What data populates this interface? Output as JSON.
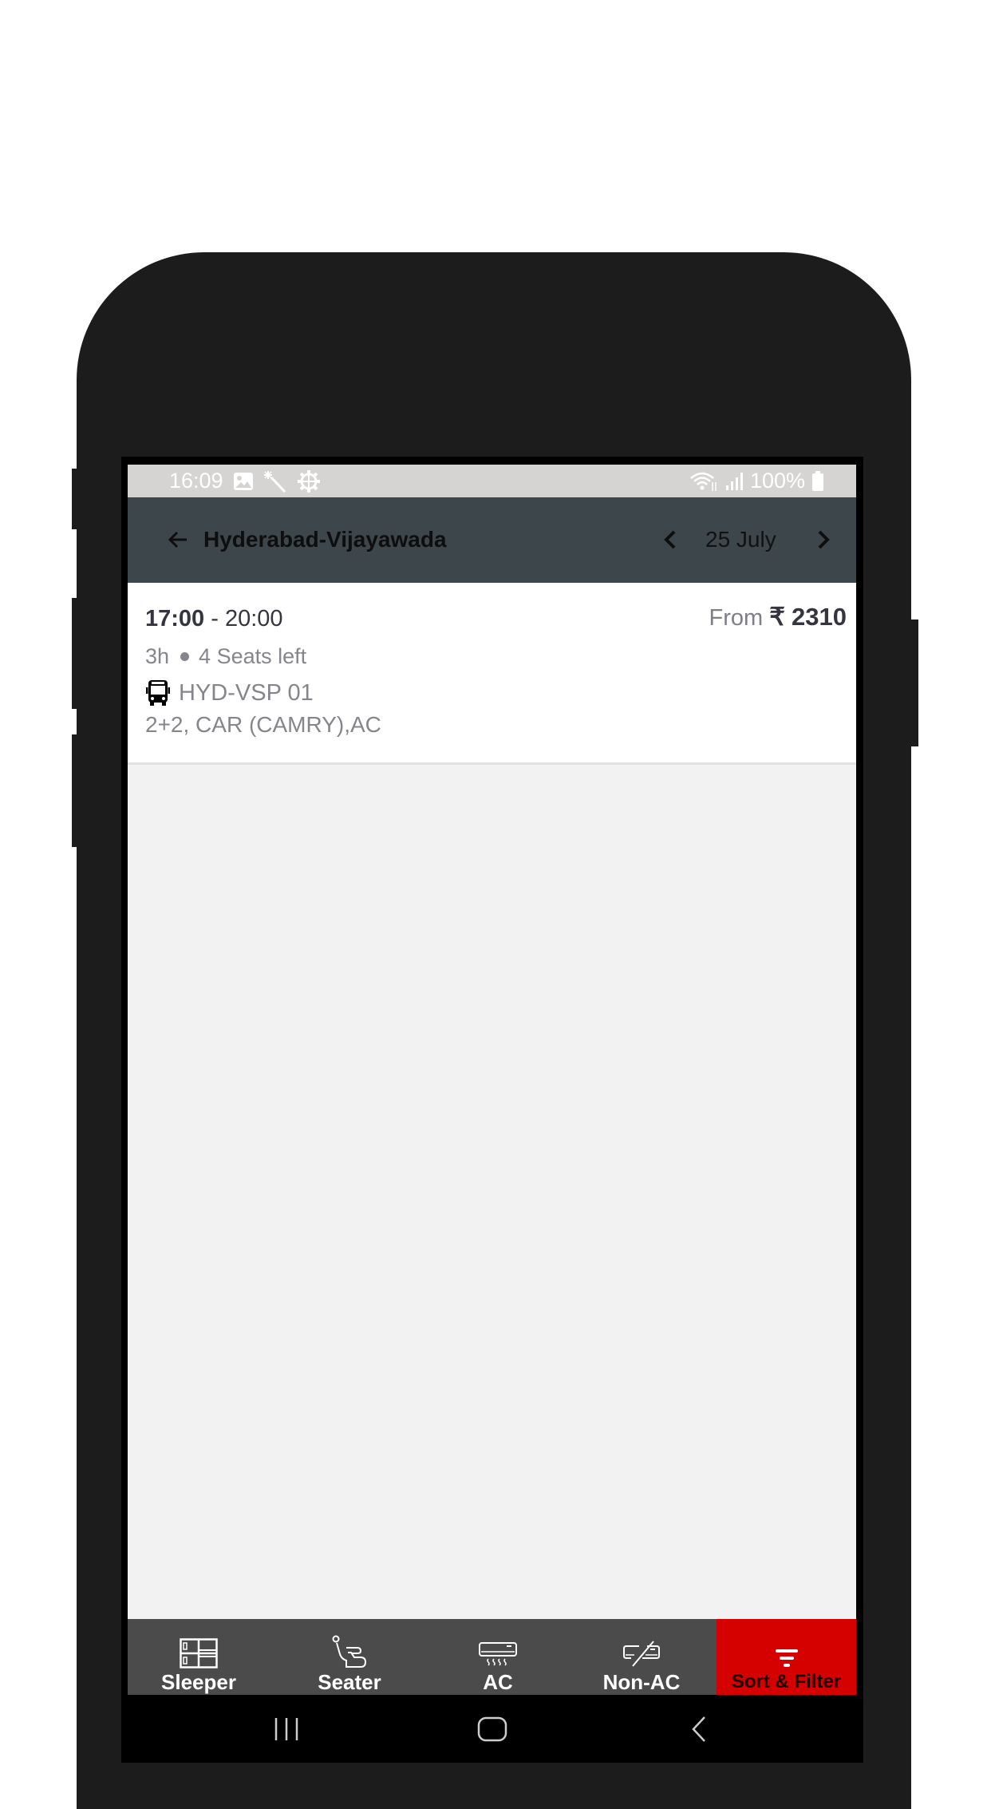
{
  "status_bar": {
    "time": "16:09",
    "left_icons": [
      "gallery-icon",
      "magic-wand-icon",
      "settings-gear-icon"
    ],
    "right_icons": [
      "wifi-icon",
      "signal-icon"
    ],
    "battery_percent": "100%"
  },
  "header": {
    "back_icon": "arrow-left-icon",
    "title": "Hyderabad-Vijayawada",
    "date": "25 July",
    "prev_date_icon": "chevron-left-icon",
    "next_date_icon": "chevron-right-icon"
  },
  "results": [
    {
      "departure": "17:00",
      "separator": " - ",
      "arrival": "20:00",
      "price_prefix": "From",
      "currency": "₹",
      "price": "2310",
      "duration": "3h",
      "seats_left": "4 Seats left",
      "bus_icon": "bus-icon",
      "bus_name": "HYD-VSP 01",
      "bus_type": "2+2, CAR (CAMRY),AC"
    }
  ],
  "filter_bar": {
    "tabs": [
      {
        "label": "Sleeper",
        "icon": "sleeper-icon"
      },
      {
        "label": "Seater",
        "icon": "seat-icon"
      },
      {
        "label": "AC",
        "icon": "ac-icon"
      },
      {
        "label": "Non-AC",
        "icon": "non-ac-icon"
      },
      {
        "label": "Sort & Filter",
        "icon": "filter-icon"
      }
    ],
    "accent_color": "#d50000"
  },
  "nav_bar": {
    "buttons": [
      "recent-apps-icon",
      "home-icon",
      "back-icon"
    ]
  },
  "colors": {
    "header_bg": "#3d464b",
    "status_bar_bg": "#d6d4d3",
    "content_bg": "#f2f2f2",
    "filter_bar_bg": "#4b4b4b"
  }
}
